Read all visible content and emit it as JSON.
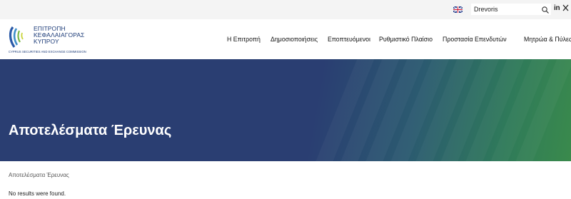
{
  "topbar": {
    "language_flag": "uk-flag-icon",
    "search": {
      "value": "Drevoris",
      "icon": "search-icon"
    },
    "social": {
      "linkedin_label": "in",
      "x_label": "𝕏"
    }
  },
  "header": {
    "logo": {
      "line1": "ΕΠΙΤΡΟΠΗ",
      "line2": "ΚΕΦΑΛΑΙΑΓΟΡΑΣ",
      "line3": "ΚΥΠΡΟΥ",
      "subtitle": "CYPRUS SECURITIES AND EXCHANGE COMMISSION"
    },
    "nav": [
      {
        "label": "Η Επιτροπή"
      },
      {
        "label": "Δημοσιοποιήσεις"
      },
      {
        "label": "Εποπτευόμενοι"
      },
      {
        "label": "Ρυθμιστικό Πλαίσιο"
      },
      {
        "label": "Προστασία Επενδυτών"
      },
      {
        "label": "Μητρώα & Πύλες"
      }
    ]
  },
  "hero": {
    "title": "Αποτελέσματα Έρευνας"
  },
  "breadcrumb": {
    "current": "Αποτελέσματα Έρευνας"
  },
  "results": {
    "message": "No results were found."
  },
  "colors": {
    "brand_navy": "#2a3e72",
    "brand_green": "#3a8a4c",
    "topbar_bg": "#f4f4f4"
  }
}
